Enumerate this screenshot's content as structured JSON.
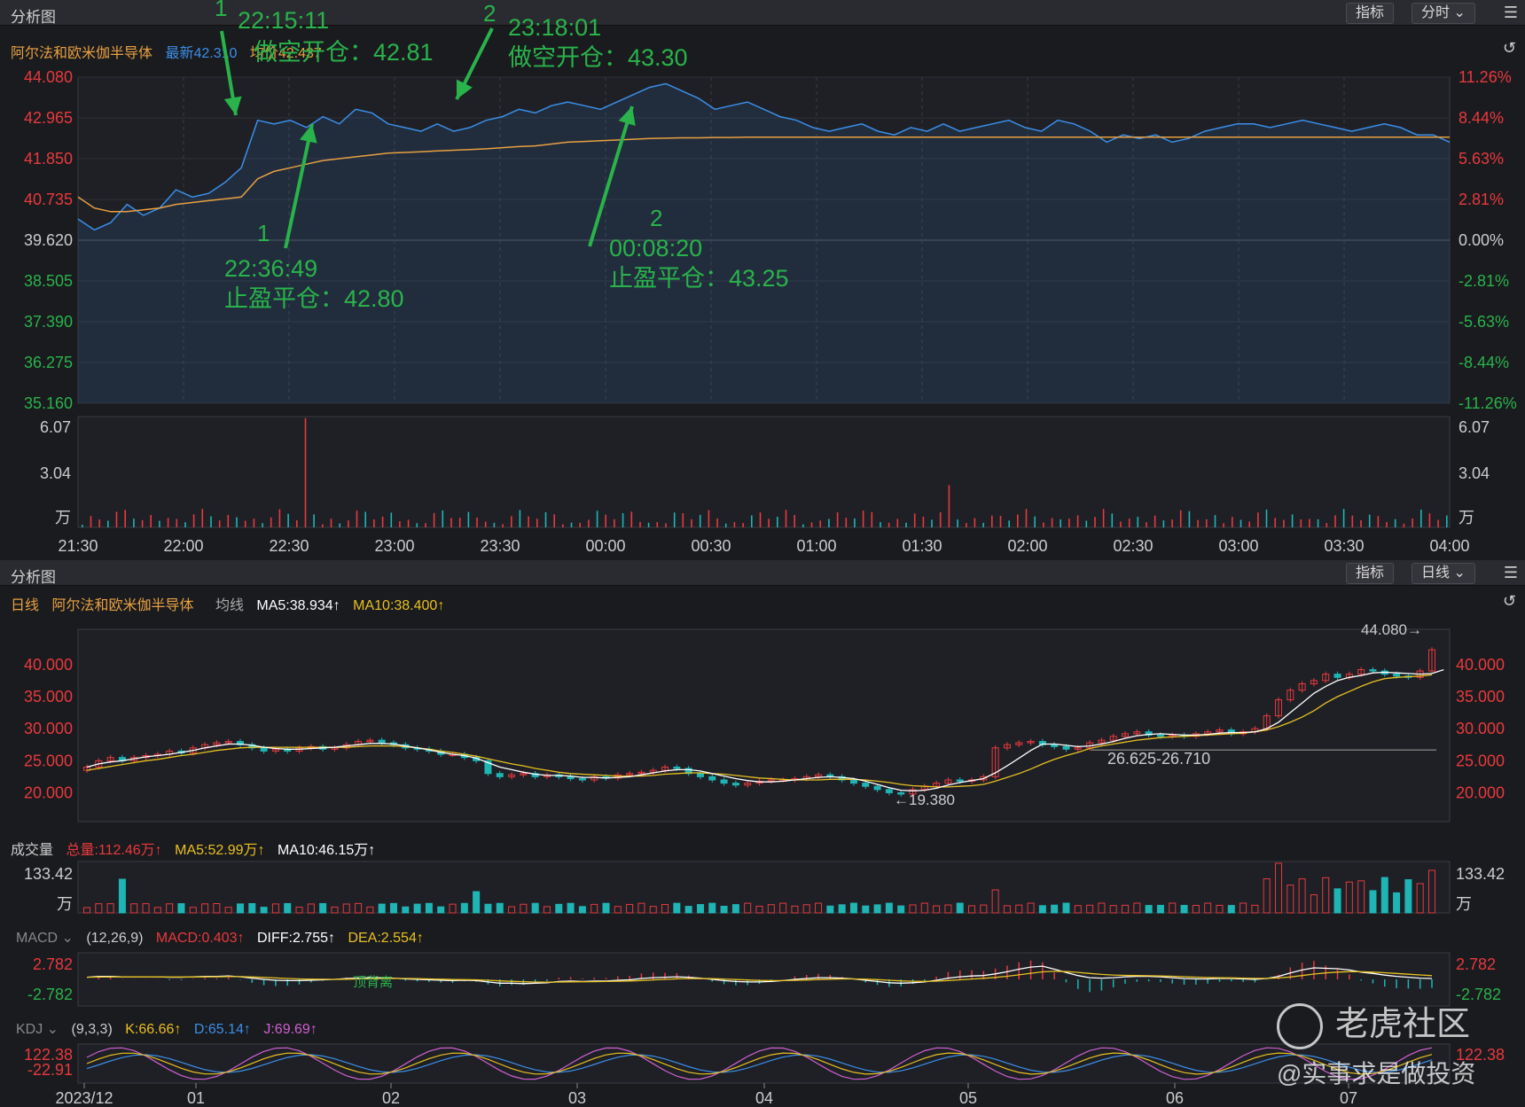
{
  "top_panel": {
    "title": "分析图",
    "btn_indicator": "指标",
    "btn_period": "分时 ⌄",
    "stock_name": "阿尔法和欧米伽半导体",
    "latest": "最新42.310",
    "avg": "均价42.437"
  },
  "bottom_panel": {
    "title": "分析图",
    "btn_indicator": "指标",
    "btn_period": "日线 ⌄",
    "period_label": "日线",
    "stock_name": "阿尔法和欧米伽半导体",
    "ma_label": "均线",
    "ma5": "MA5:38.934↑",
    "ma10": "MA10:38.400↑",
    "vol_label": "成交量",
    "vol_total": "总量:112.46万↑",
    "vol_ma5": "MA5:52.99万↑",
    "vol_ma10": "MA10:46.15万↑",
    "macd_label": "MACD ⌄",
    "macd_params": "(12,26,9)",
    "macd_val": "MACD:0.403↑",
    "diff_val": "DIFF:2.755↑",
    "dea_val": "DEA:2.554↑",
    "kdj_label": "KDJ ⌄",
    "kdj_params": "(9,3,3)",
    "k_val": "K:66.66↑",
    "d_val": "D:65.14↑",
    "j_val": "J:69.69↑"
  },
  "watermark": {
    "brand": "老虎社区",
    "author": "@实事求是做投资"
  },
  "colors": {
    "up": "#e8393d",
    "down": "#1fb5b5",
    "price": "#3b8ee8",
    "avg": "#e8a040",
    "annot": "#29b34a",
    "ma5": "#ffffff",
    "ma10": "#e8c020",
    "macd_dea": "#e8c020",
    "kdj_k": "#e8c020",
    "kdj_d": "#3b8ee8",
    "kdj_j": "#d060d0"
  },
  "chart_data": [
    {
      "type": "line",
      "name_id": "intraday",
      "y_left_ticks": [
        "44.080",
        "42.965",
        "41.850",
        "40.735",
        "39.620",
        "38.505",
        "37.390",
        "36.275",
        "35.160"
      ],
      "y_right_ticks": [
        "11.26%",
        "8.44%",
        "5.63%",
        "2.81%",
        "0.00%",
        "-2.81%",
        "-5.63%",
        "-8.44%",
        "-11.26%"
      ],
      "ylim": [
        35.16,
        44.08
      ],
      "x_ticks": [
        "21:30",
        "22:00",
        "22:30",
        "23:00",
        "23:30",
        "00:00",
        "00:30",
        "01:00",
        "01:30",
        "02:00",
        "02:30",
        "03:00",
        "03:30",
        "04:00"
      ],
      "price": [
        40.2,
        39.9,
        40.1,
        40.6,
        40.3,
        40.5,
        41.0,
        40.8,
        40.9,
        41.2,
        41.6,
        42.9,
        42.8,
        42.9,
        42.7,
        43.0,
        42.8,
        43.2,
        43.1,
        42.8,
        42.7,
        42.6,
        42.8,
        42.6,
        42.7,
        42.9,
        43.0,
        43.2,
        43.1,
        43.3,
        43.4,
        43.3,
        43.2,
        43.4,
        43.6,
        43.8,
        43.9,
        43.7,
        43.5,
        43.2,
        43.3,
        43.4,
        43.2,
        43.0,
        42.9,
        42.7,
        42.6,
        42.7,
        42.8,
        42.6,
        42.5,
        42.7,
        42.6,
        42.8,
        42.6,
        42.7,
        42.8,
        42.9,
        42.7,
        42.6,
        42.9,
        42.8,
        42.6,
        42.3,
        42.5,
        42.4,
        42.5,
        42.3,
        42.4,
        42.6,
        42.7,
        42.8,
        42.8,
        42.7,
        42.8,
        42.9,
        42.8,
        42.7,
        42.6,
        42.7,
        42.8,
        42.7,
        42.5,
        42.5,
        42.3
      ],
      "avg": [
        40.8,
        40.5,
        40.4,
        40.4,
        40.45,
        40.5,
        40.6,
        40.65,
        40.7,
        40.75,
        40.8,
        41.3,
        41.5,
        41.6,
        41.7,
        41.8,
        41.85,
        41.9,
        41.95,
        42.0,
        42.02,
        42.04,
        42.06,
        42.08,
        42.1,
        42.12,
        42.15,
        42.18,
        42.2,
        42.25,
        42.3,
        42.32,
        42.34,
        42.36,
        42.38,
        42.4,
        42.41,
        42.42,
        42.42,
        42.43,
        42.43,
        42.44,
        42.44,
        42.44,
        42.44,
        42.44,
        42.44,
        42.44,
        42.44,
        42.44,
        42.44,
        42.44,
        42.44,
        42.44,
        42.44,
        42.44,
        42.44,
        42.44,
        42.44,
        42.44,
        42.44,
        42.44,
        42.44,
        42.44,
        42.44,
        42.44,
        42.44,
        42.44,
        42.44,
        42.44,
        42.44,
        42.44,
        42.44,
        42.44,
        42.44,
        42.44,
        42.44,
        42.44,
        42.44,
        42.44,
        42.44,
        42.44,
        42.44,
        42.44,
        42.437
      ],
      "volume_ticks": [
        "6.07",
        "3.04",
        "万"
      ],
      "annotations": [
        {
          "num": "1",
          "time": "22:15:11",
          "text": "做空开仓：42.81"
        },
        {
          "num": "2",
          "time": "23:18:01",
          "text": "做空开仓：43.30"
        },
        {
          "num": "1",
          "time": "22:36:49",
          "text": "止盈平仓：42.80"
        },
        {
          "num": "2",
          "time": "00:08:20",
          "text": "止盈平仓：43.25"
        }
      ]
    },
    {
      "type": "bar",
      "name_id": "daily-candles",
      "y_ticks": [
        "40.000",
        "35.000",
        "30.000",
        "25.000",
        "20.000"
      ],
      "ylim": [
        15.5,
        45.5
      ],
      "x_ticks": [
        "2023/12",
        "01",
        "02",
        "03",
        "04",
        "05",
        "06",
        "07"
      ],
      "labels": [
        "44.080→",
        "26.625-26.710",
        "←19.380"
      ],
      "close": [
        24,
        25,
        25.5,
        25,
        25.5,
        25.8,
        26,
        26.5,
        26.2,
        27,
        27.5,
        27.8,
        28,
        27.5,
        27,
        26.5,
        26.8,
        26.5,
        27,
        27.2,
        26.8,
        27,
        27.5,
        28,
        28.2,
        27.8,
        27.5,
        27,
        26.8,
        26.5,
        26,
        26,
        25.5,
        25,
        23,
        22.5,
        22.8,
        23,
        22.5,
        22.8,
        22.5,
        22.2,
        22,
        22.5,
        22.3,
        22.8,
        23,
        23.2,
        23.5,
        24,
        23.8,
        23,
        22.5,
        22,
        21.5,
        21.2,
        21.5,
        21.8,
        22,
        22,
        22.2,
        22.5,
        22.8,
        22.5,
        22,
        21.5,
        21,
        20.5,
        20,
        19.8,
        20.5,
        21,
        21.5,
        22,
        21.8,
        22,
        22.5,
        27,
        27.5,
        27.8,
        28,
        27.5,
        27.2,
        26.8,
        27,
        27.8,
        28.2,
        28.8,
        29.2,
        29.5,
        29.0,
        28.8,
        29.0,
        28.8,
        29.2,
        29.5,
        29.8,
        29.2,
        29.5,
        30,
        32,
        34.5,
        36,
        37,
        37.5,
        38.5,
        38,
        38.5,
        39.2,
        39,
        38.5,
        38.2,
        38,
        39,
        42.3
      ],
      "ma5": [
        24,
        24.5,
        24.8,
        25,
        25.3,
        25.6,
        25.8,
        26,
        26.3,
        26.6,
        27,
        27.3,
        27.6,
        27.6,
        27.4,
        27.1,
        26.9,
        26.8,
        26.8,
        26.9,
        27,
        27.1,
        27.3,
        27.5,
        27.7,
        27.7,
        27.6,
        27.3,
        27,
        26.7,
        26.3,
        26,
        25.8,
        25.4,
        24.7,
        24,
        23.6,
        23.2,
        22.9,
        22.7,
        22.7,
        22.6,
        22.4,
        22.4,
        22.3,
        22.4,
        22.5,
        22.8,
        23.1,
        23.4,
        23.6,
        23.6,
        23.4,
        23,
        22.6,
        22.2,
        21.9,
        21.7,
        21.7,
        21.8,
        22,
        22.2,
        22.4,
        22.5,
        22.4,
        22.2,
        21.8,
        21.3,
        20.8,
        20.4,
        20.3,
        20.4,
        20.7,
        21.2,
        21.6,
        21.9,
        22.2,
        23.1,
        24.2,
        25.4,
        26.6,
        27.6,
        27.6,
        27.4,
        27.2,
        27.3,
        27.6,
        28,
        28.5,
        28.9,
        29.1,
        29.2,
        29.1,
        29,
        29.0,
        29.1,
        29.3,
        29.4,
        29.4,
        29.5,
        30,
        31,
        32.5,
        34,
        35.5,
        36.6,
        37.5,
        38,
        38.3,
        38.7,
        38.8,
        38.7,
        38.6,
        38.5,
        38.6,
        39.2
      ],
      "ma10": [
        23.5,
        23.8,
        24.1,
        24.4,
        24.7,
        25,
        25.2,
        25.5,
        25.8,
        26,
        26.3,
        26.6,
        26.8,
        27,
        27.1,
        27.1,
        27.1,
        27.1,
        27.1,
        27.1,
        27.1,
        27.1,
        27.1,
        27.2,
        27.3,
        27.3,
        27.3,
        27.2,
        27,
        26.8,
        26.5,
        26.3,
        26,
        25.7,
        25.3,
        24.9,
        24.5,
        24.2,
        23.8,
        23.5,
        23.2,
        23,
        22.9,
        22.8,
        22.7,
        22.6,
        22.6,
        22.6,
        22.7,
        22.9,
        23,
        23.1,
        23.1,
        23,
        22.9,
        22.7,
        22.5,
        22.3,
        22.2,
        22.1,
        22,
        22,
        22,
        22.1,
        22.1,
        22.1,
        22,
        21.8,
        21.6,
        21.3,
        21.1,
        21,
        20.9,
        20.9,
        21,
        21.1,
        21.3,
        21.8,
        22.4,
        23,
        23.7,
        24.5,
        25.2,
        25.8,
        26.3,
        26.9,
        27.3,
        27.6,
        27.9,
        28.2,
        28.4,
        28.6,
        28.7,
        28.8,
        28.9,
        29,
        29.1,
        29.2,
        29.3,
        29.5,
        29.8,
        30.3,
        31,
        31.8,
        32.8,
        34,
        35,
        35.8,
        36.6,
        37.3,
        37.8,
        38,
        38.1,
        38.2,
        38.4
      ]
    }
  ]
}
